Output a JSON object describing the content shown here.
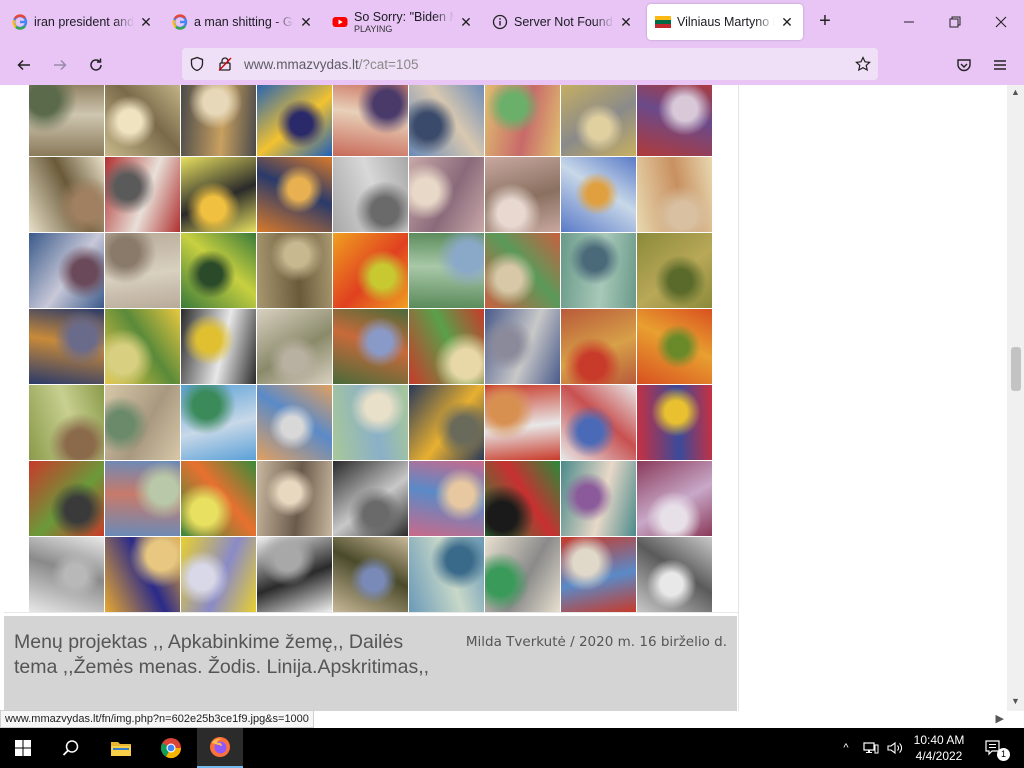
{
  "browser": {
    "tabs": [
      {
        "title": "iran president and u",
        "icon": "google-icon",
        "active": false
      },
      {
        "title": "a man shitting - Go",
        "icon": "google-icon",
        "active": false
      },
      {
        "title": "So Sorry: \"Biden My",
        "subtitle": "PLAYING",
        "icon": "youtube-icon",
        "active": false
      },
      {
        "title": "Server Not Found",
        "icon": "info-icon",
        "active": false
      },
      {
        "title": "Vilniaus Martyno M",
        "icon": "lithuania-flag-icon",
        "active": true
      }
    ],
    "new_tab_label": "+",
    "address": {
      "host": "www.mmazvydas.lt",
      "path": "/?cat=105"
    }
  },
  "gallery": {
    "rows": 7,
    "cols": 9,
    "palettes": [
      [
        "#8a7a5a",
        "#cfc6b0",
        "#5a6a4a"
      ],
      [
        "#c8b88a",
        "#7a6a4a",
        "#efe3c0"
      ],
      [
        "#4a4a4a",
        "#c8a060",
        "#e6d8b8"
      ],
      [
        "#1e5fb8",
        "#f2c230",
        "#2a2a6a"
      ],
      [
        "#c86a5a",
        "#e8d0b8",
        "#4a3a6a"
      ],
      [
        "#6a8ab8",
        "#d8c8b0",
        "#3a4a6a"
      ],
      [
        "#e0c070",
        "#c86a6a",
        "#6ab06a"
      ],
      [
        "#c8b060",
        "#8a8a8a",
        "#e0d0a0"
      ],
      [
        "#b03a3a",
        "#6a4a8a",
        "#d8c8d8"
      ],
      [
        "#e8e0c8",
        "#6a5a3a",
        "#a08060"
      ],
      [
        "#b03030",
        "#e8e0d8",
        "#5a5a5a"
      ],
      [
        "#e8e060",
        "#2a2a2a",
        "#f0c040"
      ],
      [
        "#d87a2a",
        "#2a3a6a",
        "#e8b050"
      ],
      [
        "#a8a8a8",
        "#d8d8d8",
        "#6a6a6a"
      ],
      [
        "#c8a8a8",
        "#8a6a7a",
        "#e8d8c8"
      ],
      [
        "#c8a8a0",
        "#8a7060",
        "#e8d8d0"
      ],
      [
        "#5a7ac8",
        "#c8d8e8",
        "#e0a040"
      ],
      [
        "#e8d8b0",
        "#c89060",
        "#d8c0a0"
      ],
      [
        "#3a5a8a",
        "#c8c8d8",
        "#6a4a5a"
      ],
      [
        "#b8aa98",
        "#d8d0c0",
        "#8a7a6a"
      ],
      [
        "#3a7a3a",
        "#c8d040",
        "#2a4a2a"
      ],
      [
        "#a89870",
        "#6a5a3a",
        "#c8b890"
      ],
      [
        "#f0a020",
        "#e04020",
        "#c8c830"
      ],
      [
        "#5a8a5a",
        "#a8c8a8",
        "#8aa8c8"
      ],
      [
        "#c86040",
        "#5a9a5a",
        "#d8c8a8"
      ],
      [
        "#6a9a8a",
        "#a8c8b8",
        "#4a6a7a"
      ],
      [
        "#8a8a3a",
        "#b8a858",
        "#5a6a2a"
      ],
      [
        "#2a3a6a",
        "#c88a3a",
        "#6a6a8a"
      ],
      [
        "#e8c840",
        "#5a8a3a",
        "#d8d080"
      ],
      [
        "#2a2a2a",
        "#e8e8e8",
        "#e0c030"
      ],
      [
        "#d8d0c0",
        "#8a8a6a",
        "#b8b0a0"
      ],
      [
        "#4a6a3a",
        "#c86a3a",
        "#8a9ac8"
      ],
      [
        "#c83a2a",
        "#5aa04a",
        "#e8d8a8"
      ],
      [
        "#4a5a8a",
        "#c8c8c8",
        "#8a8a9a"
      ],
      [
        "#b85a3a",
        "#d8a048",
        "#c83a2a"
      ],
      [
        "#d85020",
        "#e8a030",
        "#6a8a2a"
      ],
      [
        "#8a9a4a",
        "#c8d090",
        "#8a6a4a"
      ],
      [
        "#d8c8a8",
        "#a89880",
        "#6a8a6a"
      ],
      [
        "#5aa0d8",
        "#c8d8e8",
        "#3a8a5a"
      ],
      [
        "#e0a060",
        "#5a8ac8",
        "#d8d8d8"
      ],
      [
        "#a8c898",
        "#8ab0c8",
        "#e8e0c8"
      ],
      [
        "#2a3a5a",
        "#e8b030",
        "#6a6a5a"
      ],
      [
        "#c83a2a",
        "#e8e8e8",
        "#d89050"
      ],
      [
        "#e8e8e8",
        "#c85050",
        "#4a6ab8"
      ],
      [
        "#c83040",
        "#3a4a9a",
        "#e8c030"
      ],
      [
        "#c83a2a",
        "#6a9a3a",
        "#3a3a3a"
      ],
      [
        "#6a8ab8",
        "#c87a6a",
        "#b8c8a8"
      ],
      [
        "#3a8a3a",
        "#e87030",
        "#e8e060"
      ],
      [
        "#c8b8a0",
        "#6a5a4a",
        "#e8d8c0"
      ],
      [
        "#2a2a2a",
        "#c8c8c8",
        "#6a6a6a"
      ],
      [
        "#c86a8a",
        "#5a8ac8",
        "#e8c8a0"
      ],
      [
        "#2a8a3a",
        "#c83030",
        "#1a1a1a"
      ],
      [
        "#4a8a8a",
        "#e8d8c8",
        "#8a5a9a"
      ],
      [
        "#8a3a5a",
        "#c8a8c8",
        "#e8e0e8"
      ],
      [
        "#e8e8e8",
        "#8a8a8a",
        "#b8b8b8"
      ],
      [
        "#e8a830",
        "#2a2a8a",
        "#e8c880"
      ],
      [
        "#e8d030",
        "#8a8ac8",
        "#d8d8e8"
      ],
      [
        "#f0f0f0",
        "#2a2a2a",
        "#a8a8a8"
      ],
      [
        "#c8b898",
        "#4a4a2a",
        "#7a8ab8"
      ],
      [
        "#6a9ab8",
        "#c8d8c8",
        "#3a6a8a"
      ],
      [
        "#e8e0d0",
        "#8a8a8a",
        "#3a9a5a"
      ],
      [
        "#c83a2a",
        "#5a8ac8",
        "#e0d8c8"
      ],
      [
        "#c8c8c8",
        "#5a5a5a",
        "#e8e8e8"
      ]
    ]
  },
  "post": {
    "title": "Menų projektas ,, Apkabinkime žemę,, Dailės tema ,,Žemės menas. Žodis. Linija.Apskritimas,,",
    "author": "Milda Tverkutė",
    "separator": " / ",
    "date": "2020 m. 16 birželio d."
  },
  "statusbar": {
    "url": "www.mmazvydas.lt/fn/img.php?n=602e25b3ce1f9.jpg&s=1000"
  },
  "taskbar": {
    "clock_time": "10:40 AM",
    "clock_date": "4/4/2022",
    "notification_count": "1"
  }
}
